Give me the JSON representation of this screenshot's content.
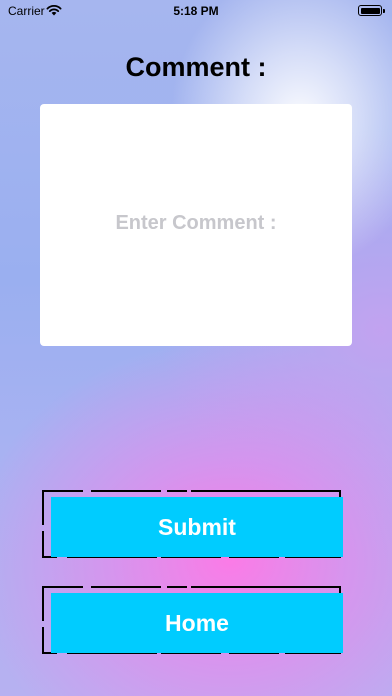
{
  "status_bar": {
    "carrier": "Carrier",
    "time": "5:18 PM"
  },
  "title": "Comment :",
  "comment": {
    "placeholder": "Enter Comment :",
    "value": ""
  },
  "buttons": {
    "submit_label": "Submit",
    "home_label": "Home"
  },
  "colors": {
    "button_background": "#00ccff",
    "button_text": "#ffffff"
  },
  "icons": {
    "wifi": "wifi-icon",
    "battery": "battery-icon"
  }
}
